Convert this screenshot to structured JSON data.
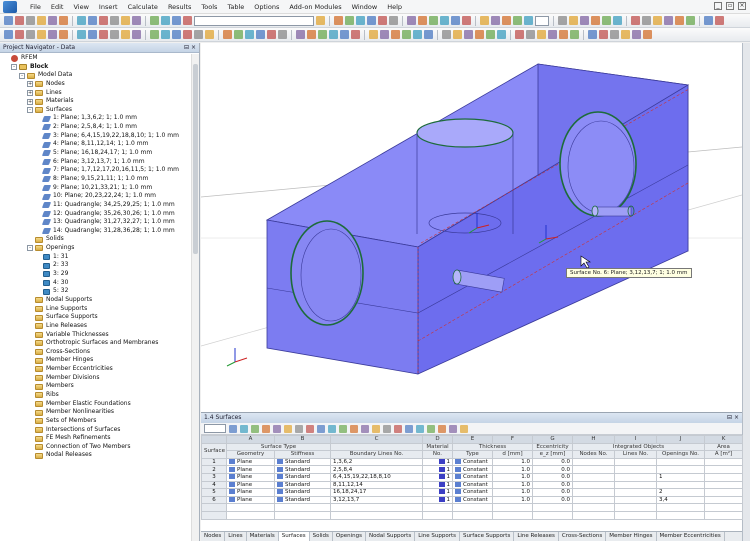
{
  "menu": [
    "File",
    "Edit",
    "View",
    "Insert",
    "Calculate",
    "Results",
    "Tools",
    "Table",
    "Options",
    "Add-on Modules",
    "Window",
    "Help"
  ],
  "navigator": {
    "title": "Project Navigator - Data",
    "items": [
      {
        "label": "RFEM",
        "level": 0,
        "icon": "root",
        "toggle": ""
      },
      {
        "label": "Block",
        "level": 1,
        "icon": "model",
        "toggle": "-",
        "bold": true
      },
      {
        "label": "Model Data",
        "level": 2,
        "icon": "folder",
        "toggle": "-"
      },
      {
        "label": "Nodes",
        "level": 3,
        "icon": "folder",
        "toggle": "+"
      },
      {
        "label": "Lines",
        "level": 3,
        "icon": "folder",
        "toggle": "+"
      },
      {
        "label": "Materials",
        "level": 3,
        "icon": "folder",
        "toggle": "+"
      },
      {
        "label": "Surfaces",
        "level": 3,
        "icon": "folder",
        "toggle": "-"
      },
      {
        "label": "1: Plane; 1,3,6,2; 1; 1.0 mm",
        "level": 4,
        "icon": "surf",
        "toggle": ""
      },
      {
        "label": "2: Plane; 2,5,8,4; 1; 1.0 mm",
        "level": 4,
        "icon": "surf",
        "toggle": ""
      },
      {
        "label": "3: Plane; 6,4,15,19,22,18,8,10; 1; 1.0 mm",
        "level": 4,
        "icon": "surf",
        "toggle": ""
      },
      {
        "label": "4: Plane; 8,11,12,14; 1; 1.0 mm",
        "level": 4,
        "icon": "surf",
        "toggle": ""
      },
      {
        "label": "5: Plane; 16,18,24,17; 1; 1.0 mm",
        "level": 4,
        "icon": "surf",
        "toggle": ""
      },
      {
        "label": "6: Plane; 3,12,13,7; 1; 1.0 mm",
        "level": 4,
        "icon": "surf",
        "toggle": ""
      },
      {
        "label": "7: Plane; 1,7,12,17,20,16,11,5; 1; 1.0 mm",
        "level": 4,
        "icon": "surf",
        "toggle": ""
      },
      {
        "label": "8: Plane; 9,15,21,11; 1; 1.0 mm",
        "level": 4,
        "icon": "surf",
        "toggle": ""
      },
      {
        "label": "9: Plane; 10,21,33,21; 1; 1.0 mm",
        "level": 4,
        "icon": "surf",
        "toggle": ""
      },
      {
        "label": "10: Plane; 20,23,22,24; 1; 1.0 mm",
        "level": 4,
        "icon": "surf",
        "toggle": ""
      },
      {
        "label": "11: Quadrangle; 34,25,29,25; 1; 1.0 mm",
        "level": 4,
        "icon": "surf",
        "toggle": ""
      },
      {
        "label": "12: Quadrangle; 35,26,30,26; 1; 1.0 mm",
        "level": 4,
        "icon": "surf",
        "toggle": ""
      },
      {
        "label": "13: Quadrangle; 31,27,32,27; 1; 1.0 mm",
        "level": 4,
        "icon": "surf",
        "toggle": ""
      },
      {
        "label": "14: Quadrangle; 31,28,36,28; 1; 1.0 mm",
        "level": 4,
        "icon": "surf",
        "toggle": ""
      },
      {
        "label": "Solids",
        "level": 3,
        "icon": "folder",
        "toggle": ""
      },
      {
        "label": "Openings",
        "level": 3,
        "icon": "folder",
        "toggle": "-"
      },
      {
        "label": "1: 31",
        "level": 4,
        "icon": "open",
        "toggle": ""
      },
      {
        "label": "2: 33",
        "level": 4,
        "icon": "open",
        "toggle": ""
      },
      {
        "label": "3: 29",
        "level": 4,
        "icon": "open",
        "toggle": ""
      },
      {
        "label": "4: 30",
        "level": 4,
        "icon": "open",
        "toggle": ""
      },
      {
        "label": "5: 32",
        "level": 4,
        "icon": "open",
        "toggle": ""
      },
      {
        "label": "Nodal Supports",
        "level": 3,
        "icon": "folder",
        "toggle": ""
      },
      {
        "label": "Line Supports",
        "level": 3,
        "icon": "folder",
        "toggle": ""
      },
      {
        "label": "Surface Supports",
        "level": 3,
        "icon": "folder",
        "toggle": ""
      },
      {
        "label": "Line Releases",
        "level": 3,
        "icon": "folder",
        "toggle": ""
      },
      {
        "label": "Variable Thicknesses",
        "level": 3,
        "icon": "folder",
        "toggle": ""
      },
      {
        "label": "Orthotropic Surfaces and Membranes",
        "level": 3,
        "icon": "folder",
        "toggle": ""
      },
      {
        "label": "Cross-Sections",
        "level": 3,
        "icon": "folder",
        "toggle": ""
      },
      {
        "label": "Member Hinges",
        "level": 3,
        "icon": "folder",
        "toggle": ""
      },
      {
        "label": "Member Eccentricities",
        "level": 3,
        "icon": "folder",
        "toggle": ""
      },
      {
        "label": "Member Divisions",
        "level": 3,
        "icon": "folder",
        "toggle": ""
      },
      {
        "label": "Members",
        "level": 3,
        "icon": "folder",
        "toggle": ""
      },
      {
        "label": "Ribs",
        "level": 3,
        "icon": "folder",
        "toggle": ""
      },
      {
        "label": "Member Elastic Foundations",
        "level": 3,
        "icon": "folder",
        "toggle": ""
      },
      {
        "label": "Member Nonlinearities",
        "level": 3,
        "icon": "folder",
        "toggle": ""
      },
      {
        "label": "Sets of Members",
        "level": 3,
        "icon": "folder",
        "toggle": ""
      },
      {
        "label": "Intersections of Surfaces",
        "level": 3,
        "icon": "folder",
        "toggle": ""
      },
      {
        "label": "FE Mesh Refinements",
        "level": 3,
        "icon": "folder",
        "toggle": ""
      },
      {
        "label": "Connection of Two Members",
        "level": 3,
        "icon": "folder",
        "toggle": ""
      },
      {
        "label": "Nodal Releases",
        "level": 3,
        "icon": "folder",
        "toggle": ""
      }
    ]
  },
  "viewport": {
    "tooltip": "Surface No. 6: Plane; 3,12,13,7; 1; 1.0 mm",
    "body_color": "#6b6cf0",
    "edge_color": "#1d6b3a"
  },
  "table": {
    "title": "1.4 Surfaces",
    "col_letters": [
      "",
      "A",
      "B",
      "C",
      "D",
      "E",
      "F",
      "G",
      "H",
      "I",
      "J",
      "K"
    ],
    "group_headers": {
      "surface_no": "Surface No.",
      "surface_type": "Surface Type",
      "material": "Material",
      "thickness": "Thickness",
      "eccentricity": "Eccentricity",
      "integrated": "Integrated Objects",
      "area": "Area"
    },
    "headers": [
      "Geometry",
      "Stiffness",
      "Boundary Lines No.",
      "No.",
      "Type",
      "d [mm]",
      "e_z [mm]",
      "Nodes No.",
      "Lines No.",
      "Openings No.",
      "A [m²]"
    ],
    "rows": [
      {
        "no": "1",
        "geometry": "Plane",
        "stiffness": "Standard",
        "lines": "1,3,6,2",
        "mat": "1",
        "type": "Constant",
        "d": "1.0",
        "ez": "0.0",
        "nodes": "",
        "lnos": "",
        "openings": ""
      },
      {
        "no": "2",
        "geometry": "Plane",
        "stiffness": "Standard",
        "lines": "2,5,8,4",
        "mat": "1",
        "type": "Constant",
        "d": "1.0",
        "ez": "0.0",
        "nodes": "",
        "lnos": "",
        "openings": ""
      },
      {
        "no": "3",
        "geometry": "Plane",
        "stiffness": "Standard",
        "lines": "6,4,15,19,22,18,8,10",
        "mat": "1",
        "type": "Constant",
        "d": "1.0",
        "ez": "0.0",
        "nodes": "",
        "lnos": "",
        "openings": "1"
      },
      {
        "no": "4",
        "geometry": "Plane",
        "stiffness": "Standard",
        "lines": "8,11,12,14",
        "mat": "1",
        "type": "Constant",
        "d": "1.0",
        "ez": "0.0",
        "nodes": "",
        "lnos": "",
        "openings": ""
      },
      {
        "no": "5",
        "geometry": "Plane",
        "stiffness": "Standard",
        "lines": "16,18,24,17",
        "mat": "1",
        "type": "Constant",
        "d": "1.0",
        "ez": "0.0",
        "nodes": "",
        "lnos": "",
        "openings": "2"
      },
      {
        "no": "6",
        "geometry": "Plane",
        "stiffness": "Standard",
        "lines": "3,12,13,7",
        "mat": "1",
        "type": "Constant",
        "d": "1.0",
        "ez": "0.0",
        "nodes": "",
        "lnos": "",
        "openings": "3,4"
      }
    ]
  },
  "tabs": [
    "Nodes",
    "Lines",
    "Materials",
    "Surfaces",
    "Solids",
    "Openings",
    "Nodal Supports",
    "Line Supports",
    "Surface Supports",
    "Line Releases",
    "Cross-Sections",
    "Member Hinges",
    "Member Eccentricities"
  ],
  "active_tab": "Surfaces"
}
